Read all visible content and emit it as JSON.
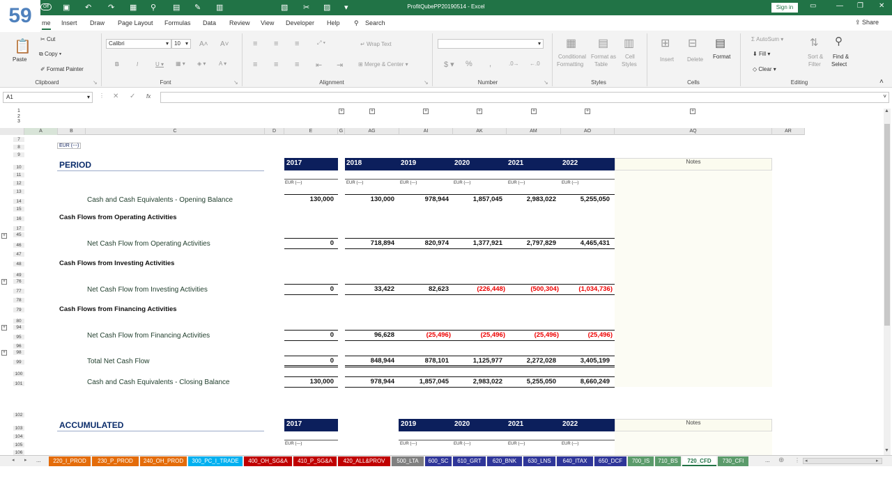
{
  "slide_number": "59",
  "window": {
    "autosave": "Off",
    "title": "ProfitQubePP20190514 - Excel",
    "sign_in": "Sign in"
  },
  "menu": {
    "tabs": [
      "me",
      "Insert",
      "Draw",
      "Page Layout",
      "Formulas",
      "Data",
      "Review",
      "View",
      "Developer",
      "Help"
    ],
    "search": "Search",
    "share": "Share"
  },
  "ribbon": {
    "clipboard": {
      "paste": "Paste",
      "cut": "Cut",
      "copy": "Copy",
      "format_painter": "Format Painter",
      "label": "Clipboard"
    },
    "font": {
      "name": "Calibri",
      "size": "10",
      "label": "Font"
    },
    "alignment": {
      "wrap_text": "Wrap Text",
      "merge_center": "Merge & Center",
      "label": "Alignment"
    },
    "number": {
      "label": "Number"
    },
    "styles": {
      "conditional": "Conditional",
      "formatting": "Formatting",
      "format_as": "Format as",
      "table": "Table",
      "cell": "Cell",
      "styles_lbl": "Styles",
      "label": "Styles"
    },
    "cells": {
      "insert": "Insert",
      "delete": "Delete",
      "format": "Format",
      "label": "Cells"
    },
    "editing": {
      "autosum": "AutoSum",
      "fill": "Fill",
      "clear": "Clear",
      "sort": "Sort &",
      "filter": "Filter",
      "find": "Find &",
      "select": "Select",
      "label": "Editing"
    }
  },
  "formula_bar": {
    "name_box": "A1",
    "fx": "fx",
    "value": ""
  },
  "columns": [
    "A",
    "B",
    "C",
    "D",
    "E",
    "G",
    "AG",
    "AI",
    "AK",
    "AM",
    "AO",
    "AQ",
    "AR"
  ],
  "rows": [
    "7",
    "8",
    "9",
    "10",
    "11",
    "12",
    "13",
    "14",
    "15",
    "16",
    "17",
    "45",
    "46",
    "47",
    "48",
    "49",
    "76",
    "77",
    "78",
    "79",
    "80",
    "94",
    "95",
    "96",
    "98",
    "99",
    "100",
    "101",
    "102",
    "103",
    "104",
    "105",
    "106"
  ],
  "sheet": {
    "currency": "EUR (---)",
    "period_title": "PERIOD",
    "accumulated_title": "ACCUMULATED",
    "notes": "Notes",
    "years_first": "2017",
    "years": [
      "2018",
      "2019",
      "2020",
      "2021",
      "2022"
    ],
    "accum_years": [
      "2019",
      "2020",
      "2021",
      "2022"
    ],
    "unit": "EUR (---)",
    "lines": [
      {
        "label": "Cash and Cash Equivalents - Opening Balance",
        "first": "130,000",
        "values": [
          "130,000",
          "978,944",
          "1,857,045",
          "2,983,022",
          "5,255,050"
        ]
      },
      {
        "label": "Net Cash Flow from Operating Activities",
        "first": "0",
        "values": [
          "718,894",
          "820,974",
          "1,377,921",
          "2,797,829",
          "4,465,431"
        ]
      },
      {
        "label": "Net Cash Flow from Investing Activities",
        "first": "0",
        "values": [
          "33,422",
          "82,623",
          "(226,448)",
          "(500,304)",
          "(1,034,736)"
        ]
      },
      {
        "label": "Net Cash Flow from Financing Activities",
        "first": "0",
        "values": [
          "96,628",
          "(25,496)",
          "(25,496)",
          "(25,496)",
          "(25,496)"
        ]
      },
      {
        "label": "Total Net Cash Flow",
        "first": "0",
        "values": [
          "848,944",
          "878,101",
          "1,125,977",
          "2,272,028",
          "3,405,199"
        ]
      },
      {
        "label": "Cash and Cash Equivalents - Closing Balance",
        "first": "130,000",
        "values": [
          "978,944",
          "1,857,045",
          "2,983,022",
          "5,255,050",
          "8,660,249"
        ]
      }
    ],
    "sections": [
      "Cash Flows from Operating Activities",
      "Cash Flows from Investing Activities",
      "Cash Flows from Financing Activities"
    ]
  },
  "sheet_tabs": [
    {
      "name": "220_I_PROD",
      "color": "#e46c0a"
    },
    {
      "name": "230_P_PROD",
      "color": "#e46c0a"
    },
    {
      "name": "240_OH_PROD",
      "color": "#e46c0a"
    },
    {
      "name": "300_PC_I_TRADE",
      "color": "#00b0f0"
    },
    {
      "name": "400_OH_SG&A",
      "color": "#c00000"
    },
    {
      "name": "410_P_SG&A",
      "color": "#c00000"
    },
    {
      "name": "420_ALL&PROV",
      "color": "#c00000"
    },
    {
      "name": "500_LTA",
      "color": "#808080"
    },
    {
      "name": "600_SC",
      "color": "#2f3699"
    },
    {
      "name": "610_GRT",
      "color": "#2f3699"
    },
    {
      "name": "620_BNK",
      "color": "#2f3699"
    },
    {
      "name": "630_LNS",
      "color": "#2f3699"
    },
    {
      "name": "640_ITAX",
      "color": "#2f3699"
    },
    {
      "name": "650_DCF",
      "color": "#2f3699"
    },
    {
      "name": "700_IS",
      "color": "#5b9b6b"
    },
    {
      "name": "710_BS",
      "color": "#5b9b6b"
    },
    {
      "name": "720_CFD",
      "color": "#ffffff"
    },
    {
      "name": "730_CFI",
      "color": "#5b9b6b"
    }
  ],
  "ellipsis": "...",
  "colors": {
    "excel_green": "#217346",
    "year_header": "#0c1f5c",
    "negative": "#e00000"
  }
}
